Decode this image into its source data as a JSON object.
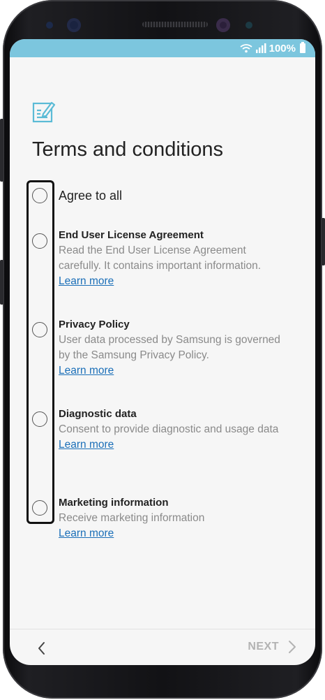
{
  "status_bar": {
    "battery_text": "100%",
    "color": "#7cc6de"
  },
  "header": {
    "icon": "edit-document-icon",
    "title": "Terms and conditions"
  },
  "agree_all": {
    "label": "Agree to all"
  },
  "items": [
    {
      "title": "End User License Agreement",
      "description": "Read the End User License Agreement carefully. It contains important information.",
      "link": "Learn more"
    },
    {
      "title": "Privacy Policy",
      "description": "User data processed by Samsung is governed by the Samsung Privacy Policy.",
      "link": "Learn more"
    },
    {
      "title": "Diagnostic data",
      "description": "Consent to provide diagnostic and usage data",
      "link": "Learn more"
    },
    {
      "title": "Marketing information",
      "description": "Receive marketing information",
      "link": "Learn more"
    }
  ],
  "navigation": {
    "back_icon": "chevron-left-icon",
    "next_label": "NEXT",
    "next_icon": "chevron-right-icon"
  },
  "colors": {
    "accent": "#7cc6de",
    "link": "#1b6fb8",
    "disabled": "#b3b3b3"
  }
}
